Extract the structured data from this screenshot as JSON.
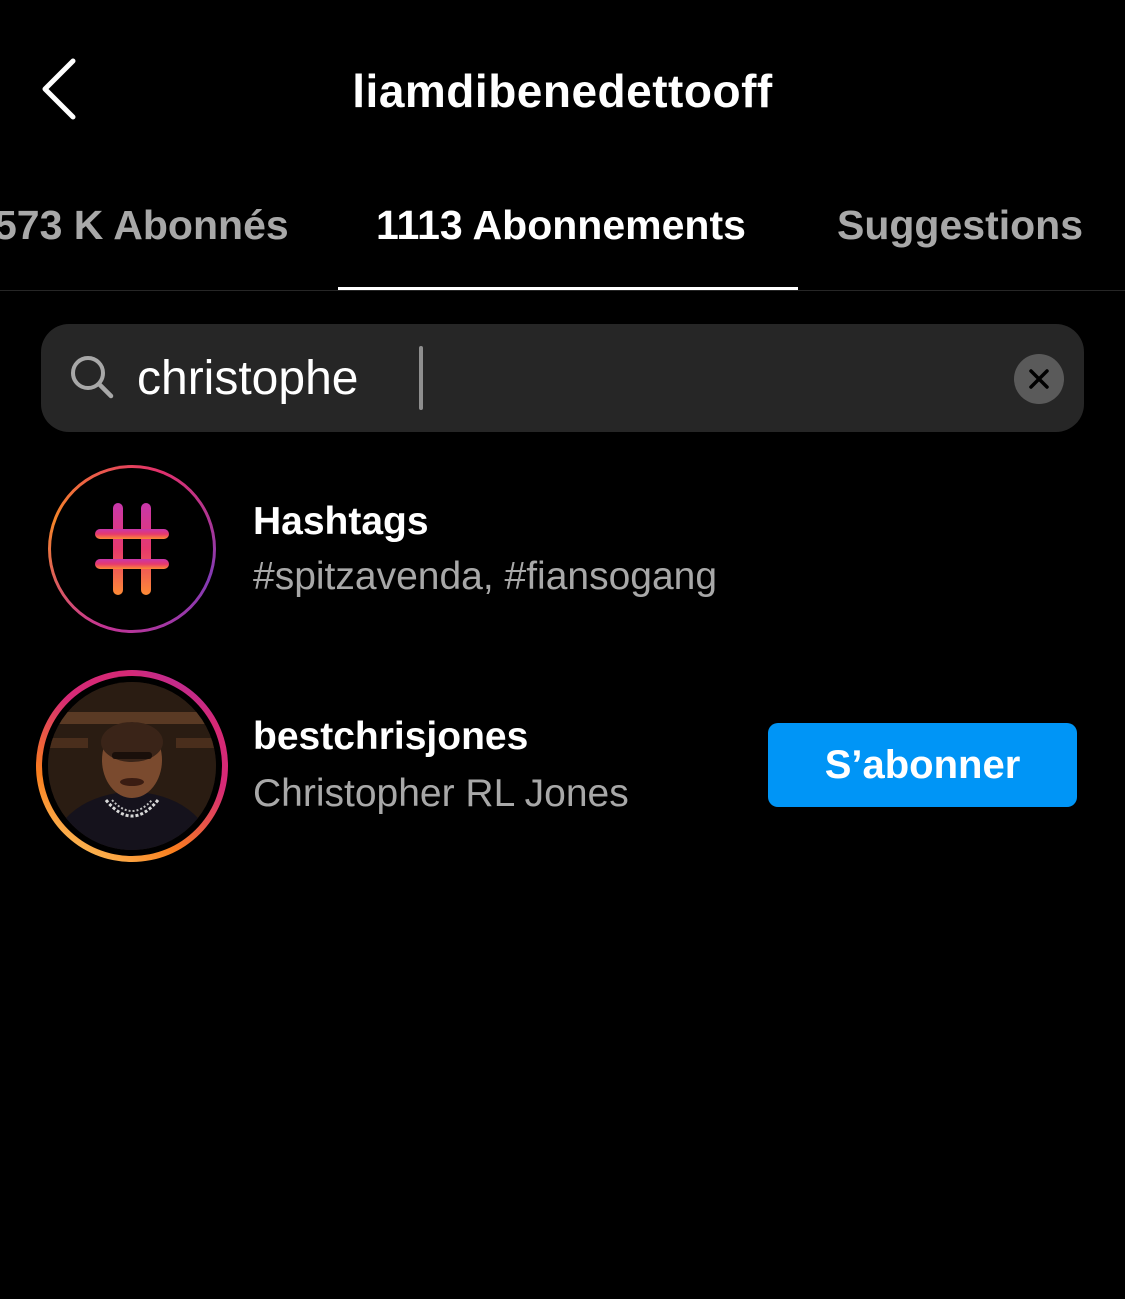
{
  "header": {
    "title": "liamdibenedettooff",
    "back_icon": "chevron-left-icon"
  },
  "tabs": [
    {
      "label": "573 K Abonnés",
      "active": false
    },
    {
      "label": "1113 Abonnements",
      "active": true
    },
    {
      "label": "Suggestions",
      "active": false
    }
  ],
  "search": {
    "value": "christophe",
    "icon": "search-icon",
    "clear_icon": "clear-icon"
  },
  "results": [
    {
      "type": "hashtags",
      "title": "Hashtags",
      "subtitle": "#spitzavenda, #fiansogang",
      "icon": "hashtag-icon"
    },
    {
      "type": "user",
      "username": "bestchrisjones",
      "full_name": "Christopher RL Jones",
      "button_label": "S’abonner",
      "has_story_ring": true
    }
  ],
  "colors": {
    "background": "#000000",
    "primary_text": "#ffffff",
    "secondary_text": "#a8a8a8",
    "search_bg": "#262626",
    "follow_button": "#0095f6",
    "gradient_pink": "#d62976",
    "gradient_orange": "#fa7e1e"
  }
}
